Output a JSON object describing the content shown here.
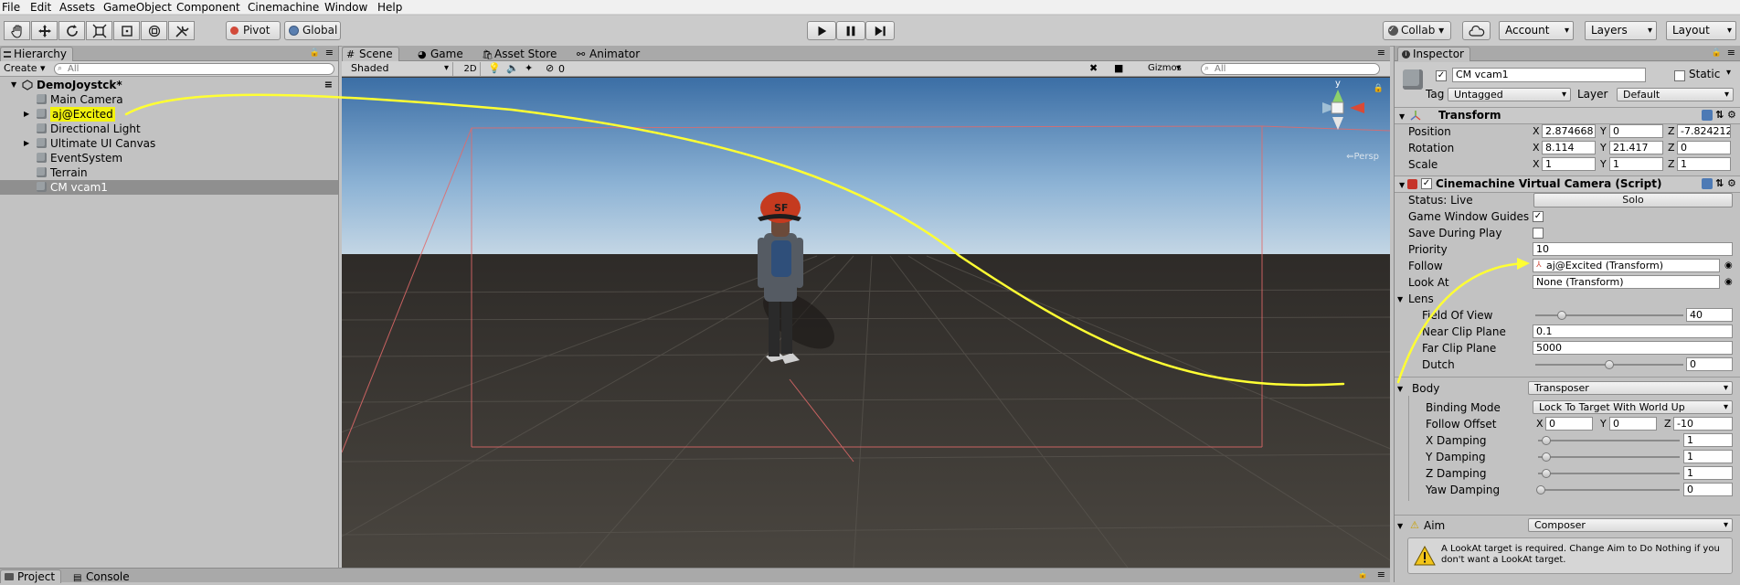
{
  "menu": [
    "File",
    "Edit",
    "Assets",
    "GameObject",
    "Component",
    "Cinemachine",
    "Window",
    "Help"
  ],
  "toolbar": {
    "pivot_label": "Pivot",
    "global_label": "Global",
    "collab_label": "Collab ▾",
    "account_label": "Account",
    "layers_label": "Layers",
    "layout_label": "Layout"
  },
  "hierarchy": {
    "tab_label": "Hierarchy",
    "create_label": "Create ▾",
    "search_placeholder": "All",
    "scene_name": "DemoJoystck*",
    "items": [
      {
        "label": "Main Camera",
        "expandable": false,
        "highlighted": false,
        "selected": false
      },
      {
        "label": "aj@Excited",
        "expandable": true,
        "highlighted": true,
        "selected": false
      },
      {
        "label": "Directional Light",
        "expandable": false,
        "highlighted": false,
        "selected": false
      },
      {
        "label": "Ultimate UI Canvas",
        "expandable": true,
        "highlighted": false,
        "selected": false
      },
      {
        "label": "EventSystem",
        "expandable": false,
        "highlighted": false,
        "selected": false
      },
      {
        "label": "Terrain",
        "expandable": false,
        "highlighted": false,
        "selected": false
      },
      {
        "label": "CM vcam1",
        "expandable": false,
        "highlighted": false,
        "selected": true
      }
    ]
  },
  "scene": {
    "tabs": [
      "Scene",
      "Game",
      "Asset Store",
      "Animator"
    ],
    "shading_mode": "Shaded",
    "mode_2d": "2D",
    "effects_count": "0",
    "gizmos_label": "Gizmos",
    "search_placeholder": "All",
    "persp_label": "Persp",
    "axis_y": "y"
  },
  "bottom_tabs": [
    "Project",
    "Console"
  ],
  "inspector": {
    "tab_label": "Inspector",
    "object_name": "CM vcam1",
    "static_label": "Static",
    "tag_label": "Tag",
    "tag_value": "Untagged",
    "layer_label": "Layer",
    "layer_value": "Default",
    "transform": {
      "title": "Transform",
      "position_label": "Position",
      "rotation_label": "Rotation",
      "scale_label": "Scale",
      "position": {
        "x": "2.874668",
        "y": "0",
        "z": "-7.824212"
      },
      "rotation": {
        "x": "8.114",
        "y": "21.417",
        "z": "0"
      },
      "scale": {
        "x": "1",
        "y": "1",
        "z": "1"
      }
    },
    "vcam": {
      "title": "Cinemachine Virtual Camera (Script)",
      "status_label": "Status: Live",
      "solo_label": "Solo",
      "game_window_guides_label": "Game Window Guides",
      "game_window_guides_checked": true,
      "save_during_play_label": "Save During Play",
      "save_during_play_checked": false,
      "priority_label": "Priority",
      "priority_value": "10",
      "follow_label": "Follow",
      "follow_value": "aj@Excited (Transform)",
      "lookat_label": "Look At",
      "lookat_value": "None (Transform)",
      "lens_label": "Lens",
      "fov_label": "Field Of View",
      "fov_value": "40",
      "fov_fraction": 0.18,
      "near_label": "Near Clip Plane",
      "near_value": "0.1",
      "far_label": "Far Clip Plane",
      "far_value": "5000",
      "dutch_label": "Dutch",
      "dutch_value": "0",
      "dutch_fraction": 0.5
    },
    "body": {
      "label": "Body",
      "mode": "Transposer",
      "binding_mode_label": "Binding Mode",
      "binding_mode_value": "Lock To Target With World Up",
      "follow_offset_label": "Follow Offset",
      "follow_offset": {
        "x": "0",
        "y": "0",
        "z": "-10"
      },
      "x_damping_label": "X Damping",
      "x_damping_value": "1",
      "y_damping_label": "Y Damping",
      "y_damping_value": "1",
      "z_damping_label": "Z Damping",
      "z_damping_value": "1",
      "yaw_damping_label": "Yaw Damping",
      "yaw_damping_value": "0"
    },
    "aim": {
      "label": "Aim",
      "mode": "Composer",
      "warning_text": "A LookAt target is required.  Change Aim to Do Nothing if you don't want a LookAt target."
    }
  },
  "colors": {
    "highlight": "#f2f20e",
    "annotation_arrow": "#ffff33",
    "selected_row": "#8f8f8f",
    "sky_top": "#3b6ea5",
    "ground": "#3f3c38"
  }
}
